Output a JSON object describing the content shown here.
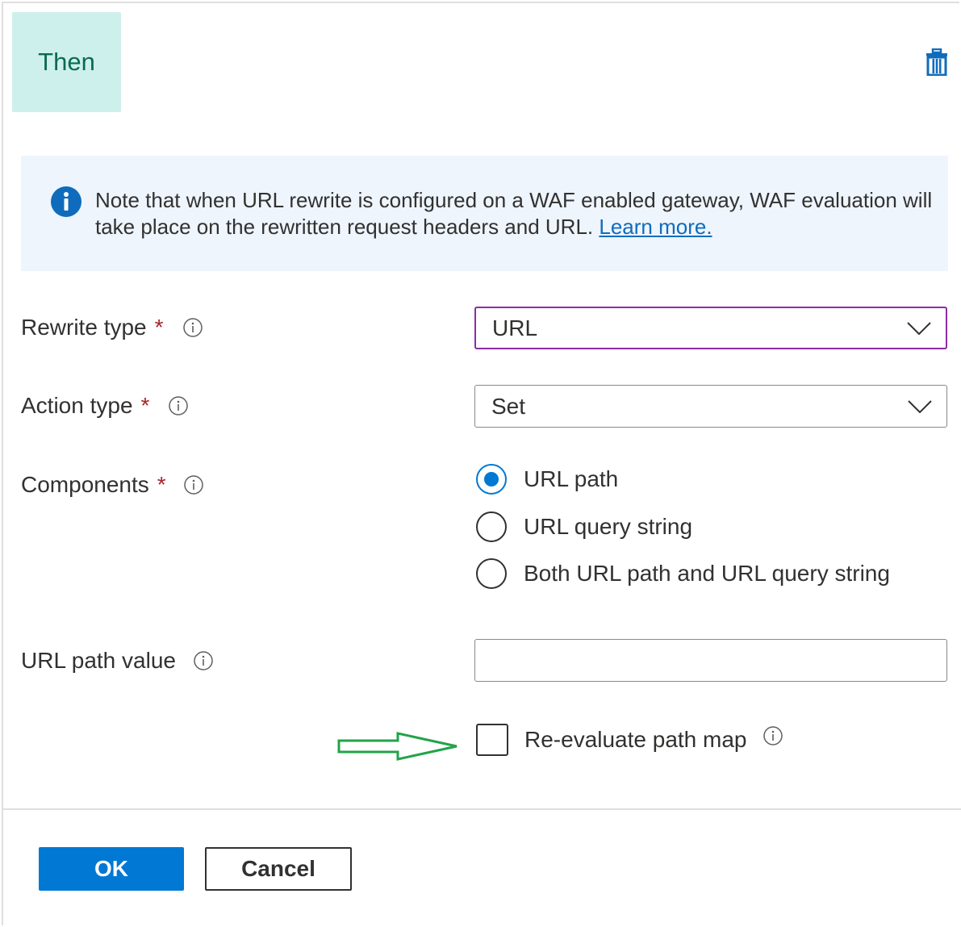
{
  "header": {
    "badge": "Then",
    "delete_icon": "trash-icon"
  },
  "info": {
    "icon": "info-circle-icon",
    "text": "Note that when URL rewrite is configured on a WAF enabled gateway, WAF evaluation will take place on the rewritten request headers and URL.",
    "link": "Learn more."
  },
  "form": {
    "rewrite_type": {
      "label": "Rewrite type",
      "required": "*",
      "value": "URL"
    },
    "action_type": {
      "label": "Action type",
      "required": "*",
      "value": "Set"
    },
    "components": {
      "label": "Components",
      "required": "*",
      "options": [
        "URL path",
        "URL query string",
        "Both URL path and URL query string"
      ],
      "selected": "URL path"
    },
    "url_path_value": {
      "label": "URL path value",
      "value": "",
      "placeholder": ""
    },
    "reevaluate": {
      "label": "Re-evaluate path map",
      "checked": false
    }
  },
  "buttons": {
    "ok": "OK",
    "cancel": "Cancel"
  },
  "colors": {
    "accent": "#0078d4",
    "badge_bg": "#cdf0ec",
    "badge_text": "#0b6a53",
    "focus_border": "#8a2da5",
    "required": "#a4262c",
    "arrow": "#22a34a"
  }
}
